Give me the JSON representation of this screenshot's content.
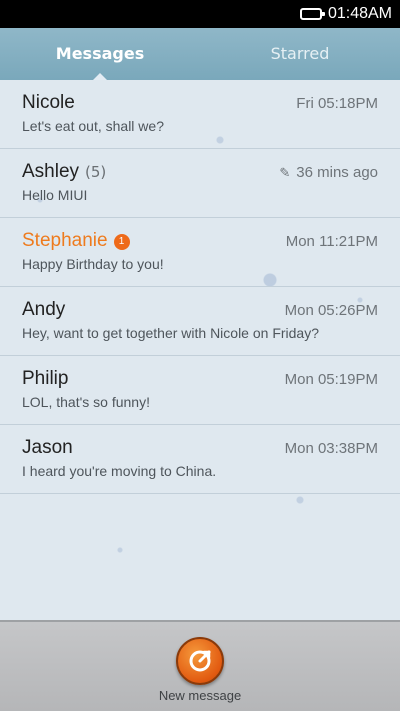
{
  "status_bar": {
    "time": "01:48AM",
    "battery_icon": "battery-icon"
  },
  "tabs": [
    {
      "label": "Messages",
      "active": true
    },
    {
      "label": "Starred",
      "active": false
    }
  ],
  "threads": [
    {
      "name": "Nicole",
      "count": "",
      "badge": "",
      "time": "Fri 05:18PM",
      "preview": "Let's eat out, shall we?",
      "unread": false,
      "draft": false
    },
    {
      "name": "Ashley",
      "count": "(5)",
      "badge": "",
      "time": "36 mins ago",
      "preview": "Hello MIUI",
      "unread": false,
      "draft": true
    },
    {
      "name": "Stephanie",
      "count": "",
      "badge": "1",
      "time": "Mon 11:21PM",
      "preview": "Happy Birthday to you!",
      "unread": true,
      "draft": false
    },
    {
      "name": "Andy",
      "count": "",
      "badge": "",
      "time": "Mon 05:26PM",
      "preview": "Hey, want to get together with Nicole on Friday?",
      "unread": false,
      "draft": false
    },
    {
      "name": "Philip",
      "count": "",
      "badge": "",
      "time": "Mon 05:19PM",
      "preview": "LOL, that's so funny!",
      "unread": false,
      "draft": false
    },
    {
      "name": "Jason",
      "count": "",
      "badge": "",
      "time": "Mon 03:38PM",
      "preview": "I heard you're moving to China.",
      "unread": false,
      "draft": false
    }
  ],
  "bottom": {
    "new_message_label": "New message",
    "icon": "compose-icon"
  },
  "colors": {
    "accent": "#ee7b1e",
    "tab_bar": "#8fb7c8",
    "badge": "#ee6a1a"
  }
}
